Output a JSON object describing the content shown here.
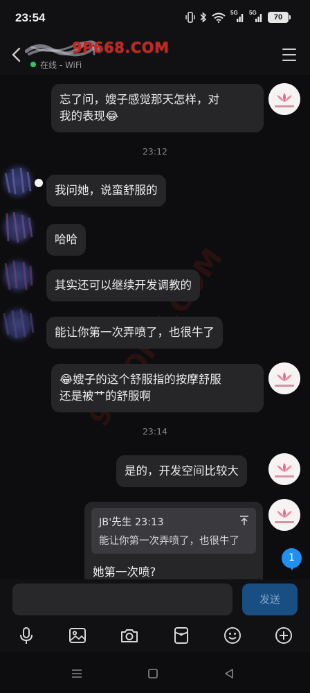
{
  "status_bar": {
    "time": "23:54",
    "battery": "70",
    "signal_label_1": "5G",
    "signal_label_2": "5G"
  },
  "header": {
    "watermark": "9P668.COM",
    "online_status": "在线 - WiFi",
    "back_icon": "chevron-left-icon",
    "menu_icon": "hamburger-menu-icon"
  },
  "messages": [
    {
      "side": "right",
      "lines": [
        "忘了问，嫂子感觉那天怎样，对",
        "我的表现😂"
      ]
    },
    {
      "type": "time",
      "text": "23:12"
    },
    {
      "side": "left",
      "lines": [
        "我问她，说蛮舒服的"
      ]
    },
    {
      "side": "left",
      "lines": [
        "哈哈"
      ]
    },
    {
      "side": "left",
      "lines": [
        "其实还可以继续开发调教的"
      ]
    },
    {
      "side": "left",
      "lines": [
        "能让你第一次弄喷了，也很牛了"
      ]
    },
    {
      "side": "right",
      "lines": [
        "😂嫂子的这个舒服指的按摩舒服",
        "还是被艹的舒服啊"
      ]
    },
    {
      "type": "time",
      "text": "23:14"
    },
    {
      "side": "right",
      "lines": [
        "是的，开发空间比较大"
      ]
    }
  ],
  "reply": {
    "quote_author": "JB'先生 23:13",
    "quote_text": "能让你第一次弄喷了，也很牛了",
    "text": "她第一次喷?"
  },
  "unread_count": "1",
  "composer": {
    "placeholder": "",
    "send_label": "发送"
  },
  "toolbar": [
    "microphone-icon",
    "image-icon",
    "camera-icon",
    "red-packet-icon",
    "emoji-icon",
    "plus-icon"
  ],
  "nav": [
    "menu-nav-icon",
    "home-nav-icon",
    "back-nav-icon"
  ],
  "colors": {
    "background": "#0d0d0f",
    "bubble": "#262629",
    "accent": "#1f8ff0",
    "online": "#2fc55b",
    "watermark": "#c2261f"
  }
}
